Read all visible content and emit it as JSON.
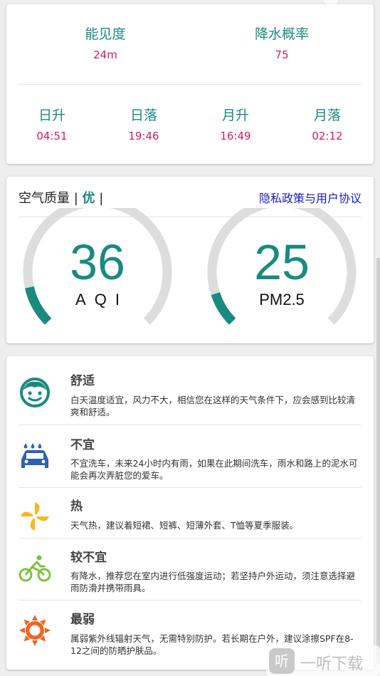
{
  "weather_details": {
    "visibility": {
      "label": "能见度",
      "value": "24m"
    },
    "precipitation": {
      "label": "降水概率",
      "value": "75"
    },
    "sunrise": {
      "label": "日升",
      "value": "04:51"
    },
    "sunset": {
      "label": "日落",
      "value": "19:46"
    },
    "moonrise": {
      "label": "月升",
      "value": "16:49"
    },
    "moonset": {
      "label": "月落",
      "value": "02:12"
    }
  },
  "air_quality": {
    "title_prefix": "空气质量 | ",
    "level": "优",
    "title_suffix": " |",
    "privacy_link": "隐私政策与用户协议",
    "aqi": {
      "value": "36",
      "unit": "AQI",
      "fraction": 0.12
    },
    "pm25": {
      "value": "25",
      "unit": "PM2.5",
      "fraction": 0.1
    }
  },
  "life_index": [
    {
      "icon": "smiley-face-icon",
      "title": "舒适",
      "desc": "白天温度适宜，风力不大，相信您在这样的天气条件下，应会感到比较清爽和舒适。"
    },
    {
      "icon": "car-wash-icon",
      "title": "不宜",
      "desc": "不宜洗车，未来24小时内有雨，如果在此期间洗车，雨水和路上的泥水可能会再次弄脏您的爱车。"
    },
    {
      "icon": "pinwheel-icon",
      "title": "热",
      "desc": "天气热，建议着短裙、短裤、短薄外套、T恤等夏季服装。"
    },
    {
      "icon": "cycling-icon",
      "title": "较不宜",
      "desc": "有降水，推荐您在室内进行低强度运动；若坚持户外运动，须注意选择避雨防滑并携带雨具。"
    },
    {
      "icon": "sun-uv-icon",
      "title": "最弱",
      "desc": "属弱紫外线辐射天气，无需特别防护。若长期在户外，建议涂擦SPF在8-12之间的防晒护肤品。"
    }
  ],
  "watermark": {
    "logo": "听",
    "text": "一听下载"
  },
  "colors": {
    "accent": "#1a8a80",
    "value_pink": "#d81b60",
    "link_blue": "#1a1acc",
    "gauge_track": "#dddddd"
  }
}
